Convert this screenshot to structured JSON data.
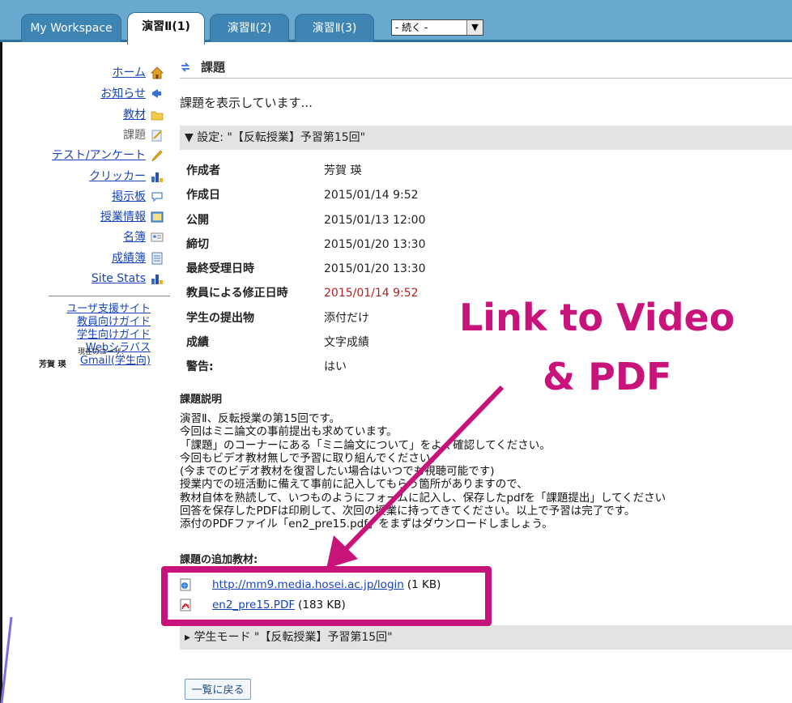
{
  "tabs": [
    {
      "label": "My Workspace"
    },
    {
      "label": "演習Ⅱ(1)"
    },
    {
      "label": "演習Ⅱ(2)"
    },
    {
      "label": "演習Ⅱ(3)"
    }
  ],
  "more_sites_select": {
    "value": "- 続く -"
  },
  "sidebar": {
    "items": [
      {
        "label": "ホーム",
        "icon": "home-icon",
        "link": true
      },
      {
        "label": "お知らせ",
        "icon": "megaphone-icon",
        "link": true
      },
      {
        "label": "教材",
        "icon": "folder-icon",
        "link": true
      },
      {
        "label": "課題",
        "icon": "assignment-icon",
        "link": false
      },
      {
        "label": "テスト/アンケート",
        "icon": "pencil-icon",
        "link": true
      },
      {
        "label": "クリッカー",
        "icon": "bar-chart-icon",
        "link": true
      },
      {
        "label": "掲示板",
        "icon": "speech-bubble-icon",
        "link": true
      },
      {
        "label": "授業情報",
        "icon": "syllabus-icon",
        "link": true
      },
      {
        "label": "名簿",
        "icon": "roster-icon",
        "link": true
      },
      {
        "label": "成績簿",
        "icon": "gradebook-icon",
        "link": true
      },
      {
        "label": "Site Stats",
        "icon": "stats-icon",
        "link": true
      }
    ],
    "external_links": [
      "ユーザ支援サイト",
      "教員向けガイド",
      "学生向けガイド",
      "Webシラバス",
      "Gmail(学生向)"
    ],
    "current_user_label": "現在のユーザ:",
    "current_user_name": "芳賀 瑛"
  },
  "main": {
    "tool_title": "課題",
    "message": "課題を表示しています...",
    "settings_header": "▼ 設定: \"【反転授業】予習第15回\"",
    "properties": [
      {
        "label": "作成者",
        "value": "芳賀 瑛"
      },
      {
        "label": "作成日",
        "value": "2015/01/14 9:52"
      },
      {
        "label": "公開",
        "value": "2015/01/13 12:00"
      },
      {
        "label": "締切",
        "value": "2015/01/20 13:30"
      },
      {
        "label": "最終受理日時",
        "value": "2015/01/20 13:30"
      },
      {
        "label": "教員による修正日時",
        "value": "2015/01/14 9:52"
      },
      {
        "label": "学生の提出物",
        "value": "添付だけ"
      },
      {
        "label": "成績",
        "value": "文字成績"
      },
      {
        "label": "警告:",
        "value": "はい"
      }
    ],
    "description_heading": "課題説明",
    "description_lines": [
      "演習Ⅱ、反転授業の第15回です。",
      "今回はミニ論文の事前提出も求めています。",
      "「課題」のコーナーにある「ミニ論文について」をよく確認してください。",
      "今回もビデオ教材無しで予習に取り組んでください。",
      "(今までのビデオ教材を復習したい場合はいつでも視聴可能です)",
      "授業内での班活動に備えて事前に記入してもらう箇所がありますので、",
      "教材自体を熟読して、いつものようにフォームに記入し、保存したpdfを「課題提出」してください",
      "回答を保存したPDFは印刷して、次回の授業に持ってきてください。以上で予習は完了です。",
      "添付のPDFファイル「en2_pre15.pdf」をまずはダウンロードしましょう。"
    ],
    "attachments_heading": "課題の追加教材:",
    "attachments": [
      {
        "icon": "web-link-icon",
        "name": "http://mm9.media.hosei.ac.jp/login",
        "size": "(1 KB)"
      },
      {
        "icon": "pdf-icon",
        "name": "en2_pre15.PDF",
        "size": "(183 KB)"
      }
    ],
    "student_mode_header": "▸ 学生モード \"【反転授業】予習第15回\"",
    "back_button": "一覧に戻る"
  },
  "annotation": {
    "line1": "Link to Video",
    "line2": "& PDF",
    "color": "#c8137a"
  }
}
